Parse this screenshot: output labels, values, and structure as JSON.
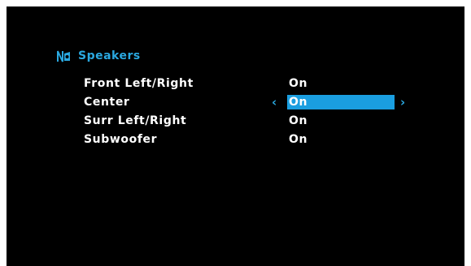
{
  "menu": {
    "title": "Speakers",
    "icon": "speakers-icon",
    "accent_color": "#2aa8e0",
    "selected_color": "#1a9ee0",
    "left_arrow": "‹",
    "right_arrow": "›",
    "items": [
      {
        "label": "Front Left/Right",
        "value": "On"
      },
      {
        "label": "Center",
        "value": "On"
      },
      {
        "label": "Surr Left/Right",
        "value": "On"
      },
      {
        "label": "Subwoofer",
        "value": "On"
      }
    ]
  }
}
